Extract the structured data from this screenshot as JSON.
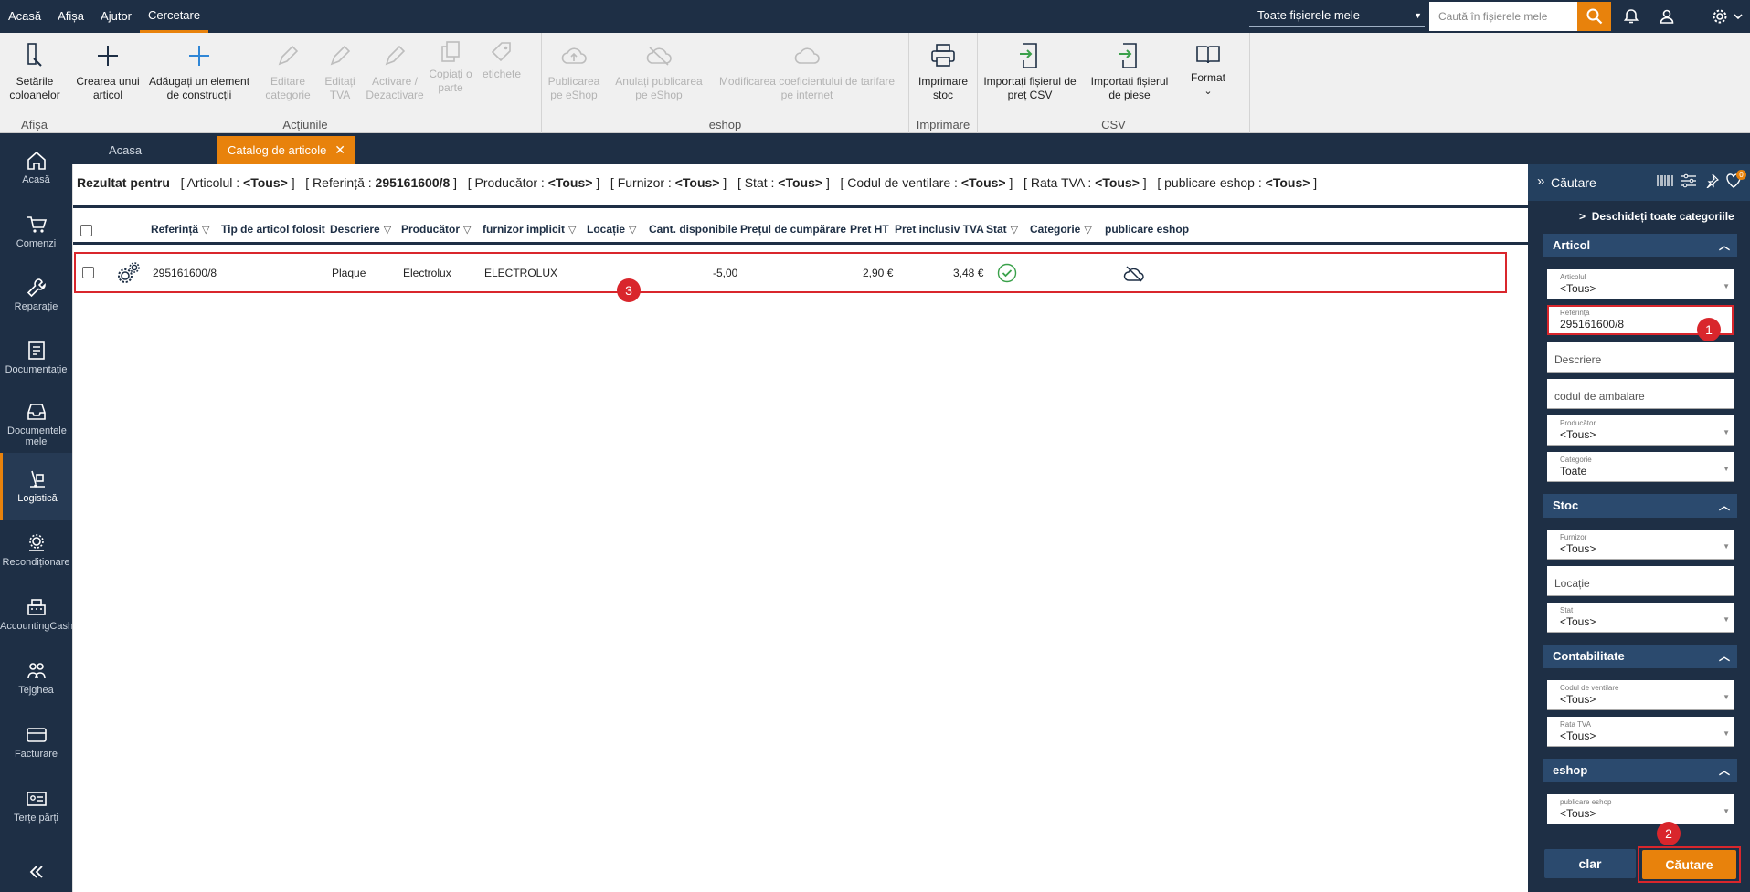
{
  "topbar": {
    "menu": [
      "Acasă",
      "Afișa",
      "Ajutor",
      "Cercetare"
    ],
    "scope_select": "Toate fișierele mele",
    "search_placeholder": "Caută în fișierele mele"
  },
  "ribbon": {
    "afisa": {
      "btn_setari": "Setările coloanelor",
      "label": "Afișa"
    },
    "actiuni": {
      "btn_creare": "Crearea unui articol",
      "btn_adaugati": "Adăugați un element de construcții",
      "btn_editare_cat": "Editare categorie",
      "btn_editati_tva": "Editați TVA",
      "btn_activare": "Activare / Dezactivare",
      "btn_copiati": "Copiați o parte",
      "btn_etichete": "etichete",
      "label": "Acțiunile"
    },
    "eshop": {
      "btn_publicarea": "Publicarea pe eShop",
      "btn_anulati": "Anulați publicarea pe eShop",
      "btn_modificarea": "Modificarea coeficientului de tarifare pe internet",
      "label": "eshop"
    },
    "imprimare": {
      "btn_imprimare": "Imprimare stoc",
      "label": "Imprimare"
    },
    "csv": {
      "btn_import_pret": "Importați fișierul de preț CSV",
      "btn_import_piese": "Importați fișierul de piese",
      "btn_format": "Format",
      "label": "CSV"
    }
  },
  "sidebar": {
    "items": [
      "Acasă",
      "Comenzi",
      "Reparație",
      "Documentație",
      "Documentele mele",
      "Logistică",
      "Recondiționare",
      "AccountingCash",
      "Tejghea",
      "Facturare",
      "Terțe părți"
    ]
  },
  "tabs": {
    "home": "Acasa",
    "catalog": "Catalog de articole"
  },
  "results": {
    "prefix": "Rezultat pentru",
    "filters": [
      {
        "name": "Articolul",
        "value": "<Tous>"
      },
      {
        "name": "Referință",
        "value": "295161600/8"
      },
      {
        "name": "Producător",
        "value": "<Tous>"
      },
      {
        "name": "Furnizor",
        "value": "<Tous>"
      },
      {
        "name": "Stat",
        "value": "<Tous>"
      },
      {
        "name": "Codul de ventilare",
        "value": "<Tous>"
      },
      {
        "name": "Rata TVA",
        "value": "<Tous>"
      },
      {
        "name": "publicare eshop",
        "value": "<Tous>"
      }
    ]
  },
  "table": {
    "headers": {
      "referinta": "Referință",
      "tip": "Tip de articol folosit",
      "descriere": "Descriere",
      "producator": "Producător",
      "furnizor": "furnizor implicit",
      "locatie": "Locație",
      "cant": "Cant. disponibile",
      "pret_cumparare": "Prețul de cumpărare",
      "pret_ht": "Pret HT",
      "pret_tva": "Pret inclusiv TVA",
      "stat": "Stat",
      "categorie": "Categorie",
      "publicare": "publicare eshop"
    },
    "row": {
      "referinta": "295161600/8",
      "descriere": "Plaque",
      "producator": "Electrolux",
      "furnizor": "ELECTROLUX",
      "cant": "-5,00",
      "pret_ht": "2,90 €",
      "pret_tva": "3,48 €"
    }
  },
  "search_panel": {
    "title": "Căutare",
    "badge_count": "0",
    "open_all": "Deschideți toate categoriile",
    "sections": {
      "articol": "Articol",
      "stoc": "Stoc",
      "contabilitate": "Contabilitate",
      "eshop": "eshop"
    },
    "fields": {
      "articolul_label": "Articolul",
      "articolul_value": "<Tous>",
      "referinta_label": "Referință",
      "referinta_value": "295161600/8",
      "descriere_ph": "Descriere",
      "ambalare_ph": "codul de ambalare",
      "producator_label": "Producător",
      "producator_value": "<Tous>",
      "categorie_label": "Categorie",
      "categorie_value": "Toate",
      "furnizor_label": "Furnizor",
      "furnizor_value": "<Tous>",
      "locatie_ph": "Locație",
      "stat_label": "Stat",
      "stat_value": "<Tous>",
      "ventilare_label": "Codul de ventilare",
      "ventilare_value": "<Tous>",
      "rata_label": "Rata TVA",
      "rata_value": "<Tous>",
      "publicare_label": "publicare eshop",
      "publicare_value": "<Tous>"
    },
    "btn_clear": "clar",
    "btn_search": "Căutare"
  },
  "annotations": [
    "1",
    "2",
    "3"
  ],
  "colors": {
    "navy": "#1e2f45",
    "accent": "#e8820c",
    "highlight": "#d9262c"
  }
}
